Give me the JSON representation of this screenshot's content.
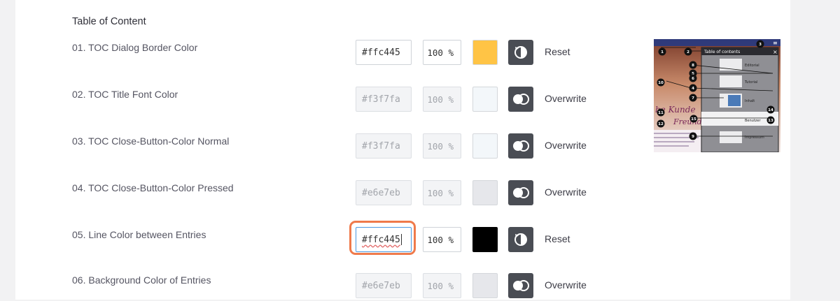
{
  "section": {
    "title": "Table of Content"
  },
  "rows": [
    {
      "label": "01. TOC Dialog Border Color",
      "hex": "#ffc445",
      "percent": "100",
      "unit": "%",
      "swatch": "#ffc445",
      "action": "Reset",
      "state": "custom"
    },
    {
      "label": "02. TOC Title Font Color",
      "hex": "#f3f7fa",
      "percent": "100",
      "unit": "%",
      "swatch": "#f3f7fa",
      "action": "Overwrite",
      "state": "default"
    },
    {
      "label": "03. TOC Close-Button-Color Normal",
      "hex": "#f3f7fa",
      "percent": "100",
      "unit": "%",
      "swatch": "#f3f7fa",
      "action": "Overwrite",
      "state": "default"
    },
    {
      "label": "04. TOC Close-Button-Color Pressed",
      "hex": "#e6e7eb",
      "percent": "100",
      "unit": "%",
      "swatch": "#e6e7eb",
      "action": "Overwrite",
      "state": "default"
    },
    {
      "label": "05. Line Color between Entries",
      "hex": "#ffc445",
      "percent": "100",
      "unit": "%",
      "swatch": "#000000",
      "action": "Reset",
      "state": "custom"
    },
    {
      "label": "06. Background Color of Entries",
      "hex": "#e6e7eb",
      "percent": "100",
      "unit": "%",
      "swatch": "#e6e7eb",
      "action": "Overwrite",
      "state": "default"
    }
  ],
  "preview": {
    "header_text": "Table of contents",
    "close_glyph": "×",
    "menu_glyph": "≡",
    "entries": [
      "Editorial",
      "Tutorial",
      "Inhalt",
      "Benutzer",
      "Impressum"
    ],
    "script_text_1": "be Kunde",
    "script_text_2": "Freund",
    "markers": [
      "1",
      "2",
      "3",
      "4",
      "5",
      "6",
      "7",
      "8",
      "9",
      "10",
      "11",
      "12",
      "13",
      "14",
      "15"
    ]
  },
  "colors": {
    "focus_ring": "#ef7a4b",
    "toggle_bg": "#4a4d54",
    "preview_header": "#2f3a7a"
  }
}
